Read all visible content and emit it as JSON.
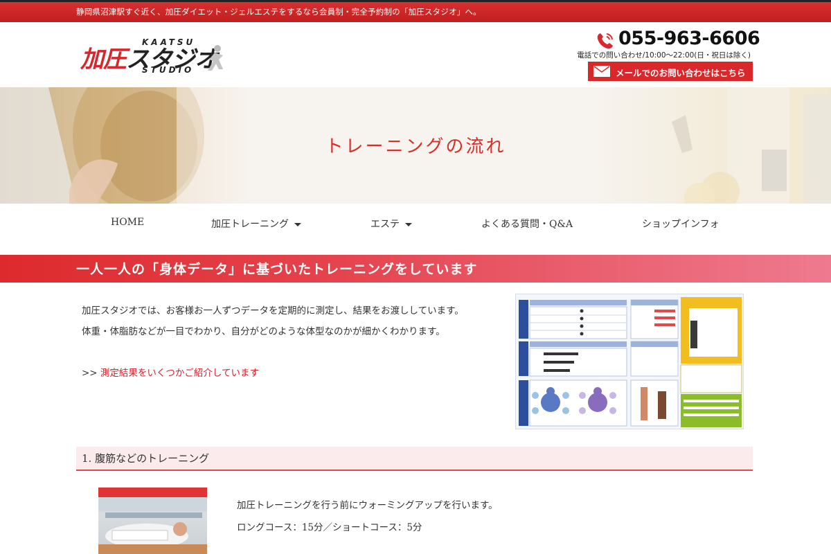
{
  "topbar": {
    "text": "静岡県沼津駅すぐ近く、加圧ダイエット・ジェルエステをするなら会員制・完全予約制の「加圧スタジオ」へ。"
  },
  "header": {
    "logo": {
      "kanji_red": "加圧",
      "kanji_dark": "スタジオ",
      "latin_top": "KAATSU",
      "latin_bottom": "STUDIO"
    },
    "phone": {
      "number": "055-963-6606",
      "hours": "電話での問い合わせ/10:00〜22:00(日・祝日は除く)"
    },
    "mail_button": {
      "label": "メールでのお問い合わせはこちら"
    }
  },
  "hero": {
    "title": "トレーニングの流れ"
  },
  "nav": {
    "items": [
      {
        "label": "HOME",
        "has_dropdown": false
      },
      {
        "label": "加圧トレーニング",
        "has_dropdown": true
      },
      {
        "label": "エステ",
        "has_dropdown": true
      },
      {
        "label": "よくある質問・Q&A",
        "has_dropdown": false
      },
      {
        "label": "ショップインフォ",
        "has_dropdown": false
      }
    ]
  },
  "section1": {
    "title": "一人一人の「身体データ」に基づいたトレーニングをしています",
    "paragraphs": [
      "加圧スタジオでは、お客様お一人ずつデータを定期的に測定し、結果をお渡ししています。",
      "体重・体脂肪などが一目でわかり、自分がどのような体型なのかが細かくわかります。"
    ],
    "link": {
      "prefix": ">> ",
      "text": "測定結果をいくつかご紹介しています"
    }
  },
  "section2": {
    "title": "1. 腹筋などのトレーニング",
    "paragraphs": [
      "加圧トレーニングを行う前にウォーミングアップを行います。",
      "ロングコース：15分／ショートコース：5分"
    ]
  },
  "colors": {
    "brand_red": "#d9272a",
    "band_gradient_end": "#ee7a8f",
    "datasheet_blue": "#2d4e9c",
    "datasheet_yellow": "#f2bd1e",
    "datasheet_green": "#8bbd2a"
  }
}
